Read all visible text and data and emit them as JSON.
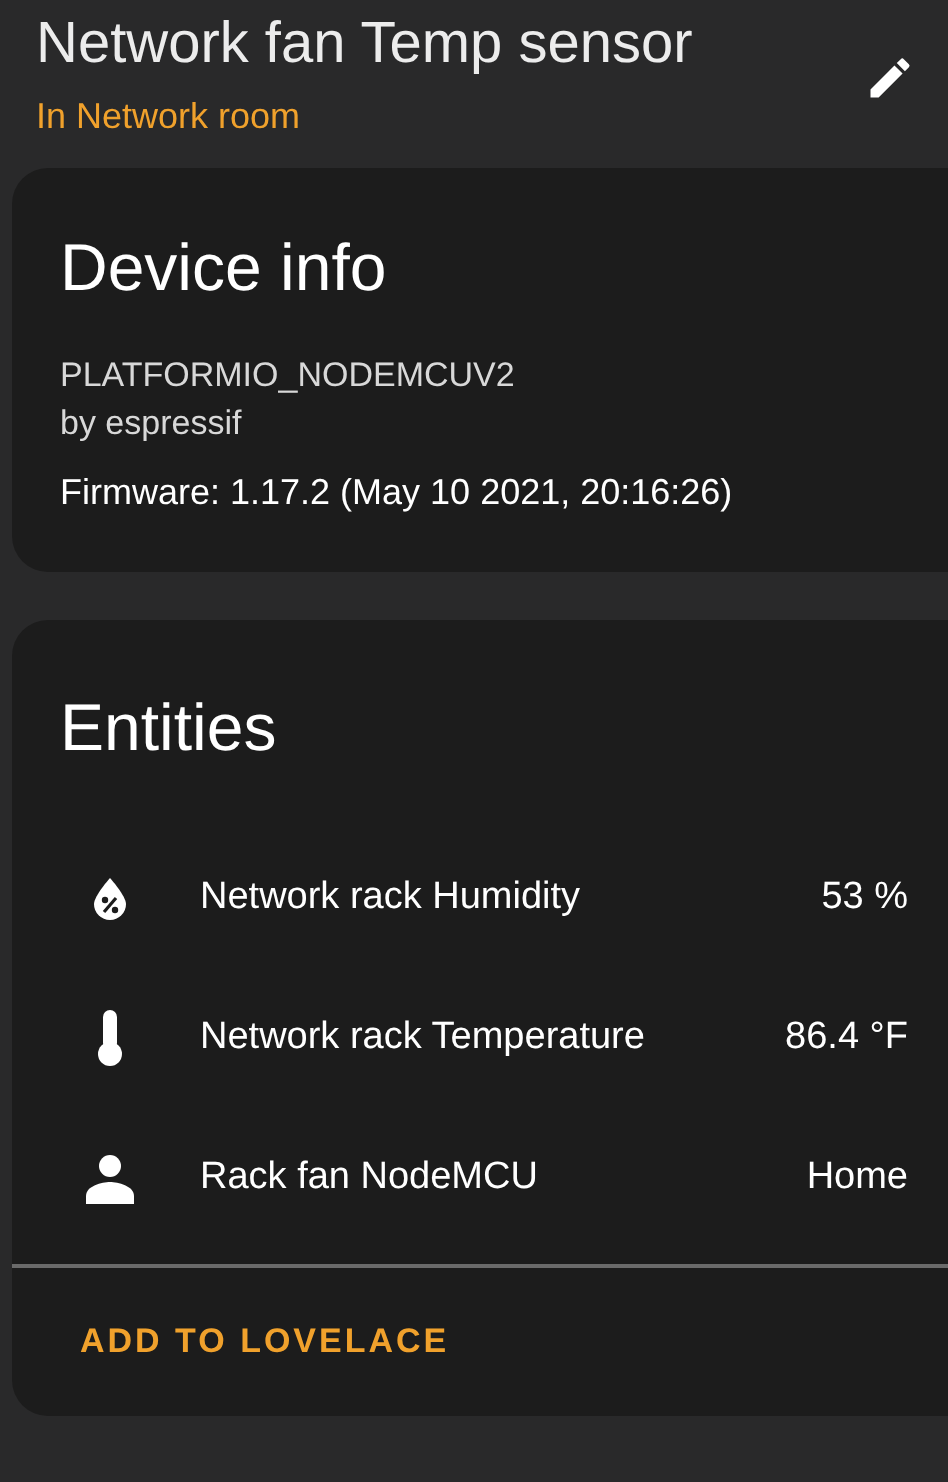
{
  "header": {
    "title": "Network fan Temp sensor",
    "subtitle": "In Network room"
  },
  "device_info": {
    "title": "Device info",
    "model": "PLATFORMIO_NODEMCUV2",
    "manufacturer": "by espressif",
    "firmware": "Firmware: 1.17.2 (May 10 2021, 20:16:26)"
  },
  "entities": {
    "title": "Entities",
    "items": [
      {
        "kind": "humidity",
        "name": "Network rack Humidity",
        "state": "53 %"
      },
      {
        "kind": "temperature",
        "name": "Network rack Temperature",
        "state": "86.4 °F"
      },
      {
        "kind": "person",
        "name": "Rack fan NodeMCU",
        "state": "Home"
      }
    ],
    "action": "ADD TO LOVELACE"
  }
}
